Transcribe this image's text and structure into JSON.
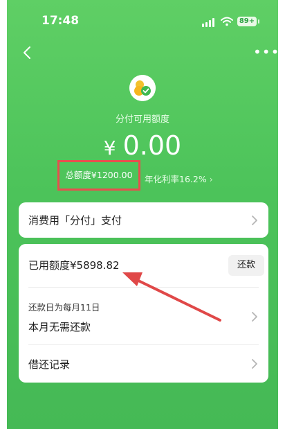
{
  "status_bar": {
    "time": "17:48",
    "battery": "89+"
  },
  "header": {
    "title": "分付可用额度",
    "currency": "¥",
    "available": "0.00"
  },
  "limits": {
    "total": "总额度¥1200.00",
    "rate": "年化利率16.2%"
  },
  "pay_card": {
    "label": "消费用「分付」支付"
  },
  "usage": {
    "used": "已用额度¥5898.82",
    "repay_button": "还款",
    "due_note": "还款日为每月11日",
    "due_status": "本月无需还款",
    "records": "借还记录"
  },
  "colors": {
    "bg_green": "#4cc35a",
    "highlight_red": "#e84e4e",
    "arrow_red": "#e04848"
  }
}
